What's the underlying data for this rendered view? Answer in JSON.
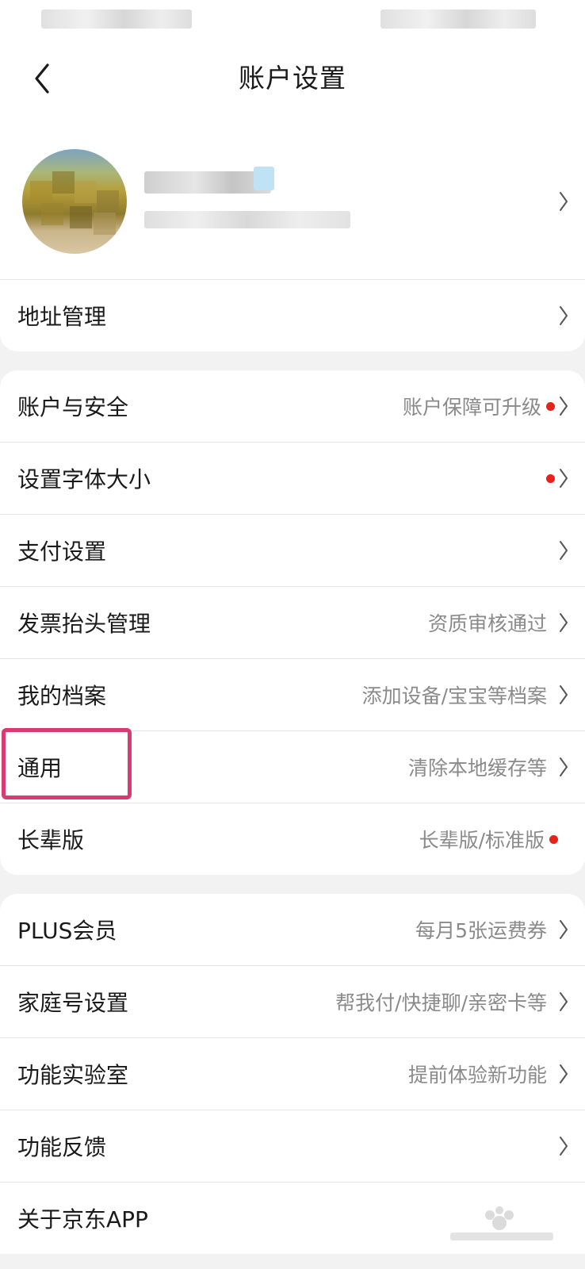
{
  "header": {
    "title": "账户设置"
  },
  "address_group": {
    "items": [
      {
        "label": "地址管理",
        "value": "",
        "dot": false
      }
    ]
  },
  "account_group": {
    "items": [
      {
        "label": "账户与安全",
        "value": "账户保障可升级",
        "dot": true
      },
      {
        "label": "设置字体大小",
        "value": "",
        "dot": true
      },
      {
        "label": "支付设置",
        "value": "",
        "dot": false
      },
      {
        "label": "发票抬头管理",
        "value": "资质审核通过",
        "dot": false
      },
      {
        "label": "我的档案",
        "value": "添加设备/宝宝等档案",
        "dot": false
      },
      {
        "label": "通用",
        "value": "清除本地缓存等",
        "dot": false
      },
      {
        "label": "长辈版",
        "value": "长辈版/标准版",
        "dot": true
      }
    ]
  },
  "more_group": {
    "items": [
      {
        "label": "PLUS会员",
        "value": "每月5张运费券",
        "dot": false
      },
      {
        "label": "家庭号设置",
        "value": "帮我付/快捷聊/亲密卡等",
        "dot": false
      },
      {
        "label": "功能实验室",
        "value": "提前体验新功能",
        "dot": false
      },
      {
        "label": "功能反馈",
        "value": "",
        "dot": false
      },
      {
        "label": "关于京东APP",
        "value": "",
        "dot": false
      }
    ]
  },
  "colors": {
    "badge_dot": "#e8211a",
    "highlight_box": "#d93a74",
    "secondary_text": "#8a8a8a"
  },
  "icons": {
    "back": "chevron-left-icon",
    "row_arrow": "chevron-right-icon"
  }
}
